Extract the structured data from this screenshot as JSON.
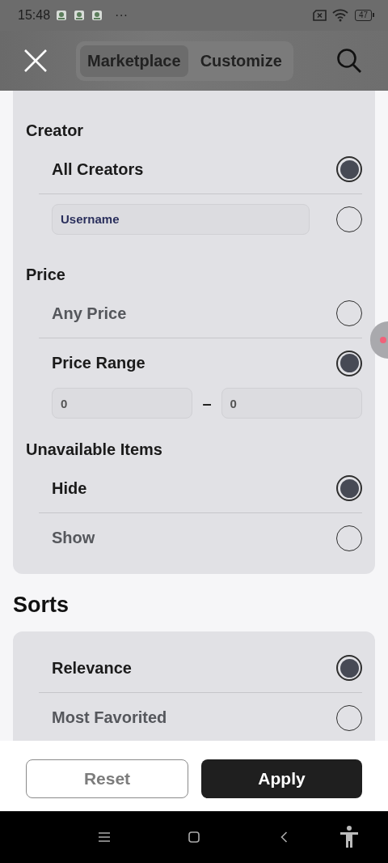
{
  "status_bar": {
    "time": "15:48",
    "more": "···",
    "battery": "47"
  },
  "header": {
    "tabs": [
      {
        "label": "Marketplace",
        "selected": true
      },
      {
        "label": "Customize",
        "selected": false
      }
    ]
  },
  "filter_groups": [
    {
      "title": "Creator",
      "options": [
        {
          "kind": "radio",
          "label": "All Creators",
          "selected": true
        },
        {
          "kind": "field",
          "placeholder": "Username",
          "selected": false
        }
      ]
    },
    {
      "title": "Price",
      "options": [
        {
          "kind": "radio",
          "label": "Any Price",
          "selected": false
        },
        {
          "kind": "range",
          "label": "Price Range",
          "selected": true,
          "min": "0",
          "separator": "–",
          "max": "0"
        }
      ]
    },
    {
      "title": "Unavailable Items",
      "options": [
        {
          "kind": "radio",
          "label": "Hide",
          "selected": true
        },
        {
          "kind": "radio",
          "label": "Show",
          "selected": false
        }
      ]
    }
  ],
  "sorts": {
    "title": "Sorts",
    "options": [
      {
        "kind": "radio",
        "label": "Relevance",
        "selected": true
      },
      {
        "kind": "radio",
        "label": "Most Favorited",
        "selected": false
      }
    ]
  },
  "actions": [
    {
      "kind": "secondary",
      "label": "Reset"
    },
    {
      "kind": "primary",
      "label": "Apply"
    }
  ]
}
